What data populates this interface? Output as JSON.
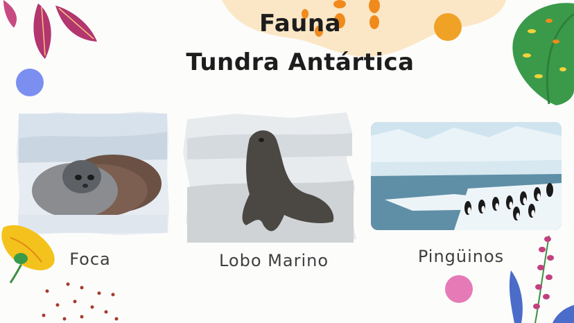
{
  "slide": {
    "title_line1": "Fauna",
    "title_line2": "Tundra Antártica",
    "animals": [
      {
        "caption": "Foca",
        "image": "seal-photo"
      },
      {
        "caption": "Lobo Marino",
        "image": "sea-lion-photo"
      },
      {
        "caption": "Pingüinos",
        "image": "penguins-photo"
      }
    ]
  },
  "colors": {
    "background": "#fcfcfb",
    "title": "#1d1d1d",
    "caption": "#3f3f3f",
    "accent_orange": "#f0a227",
    "accent_blue": "#7b8ff0",
    "accent_pink": "#e57ab6",
    "leaf_green": "#3a9a4a",
    "leaf_magenta": "#b3366f"
  }
}
